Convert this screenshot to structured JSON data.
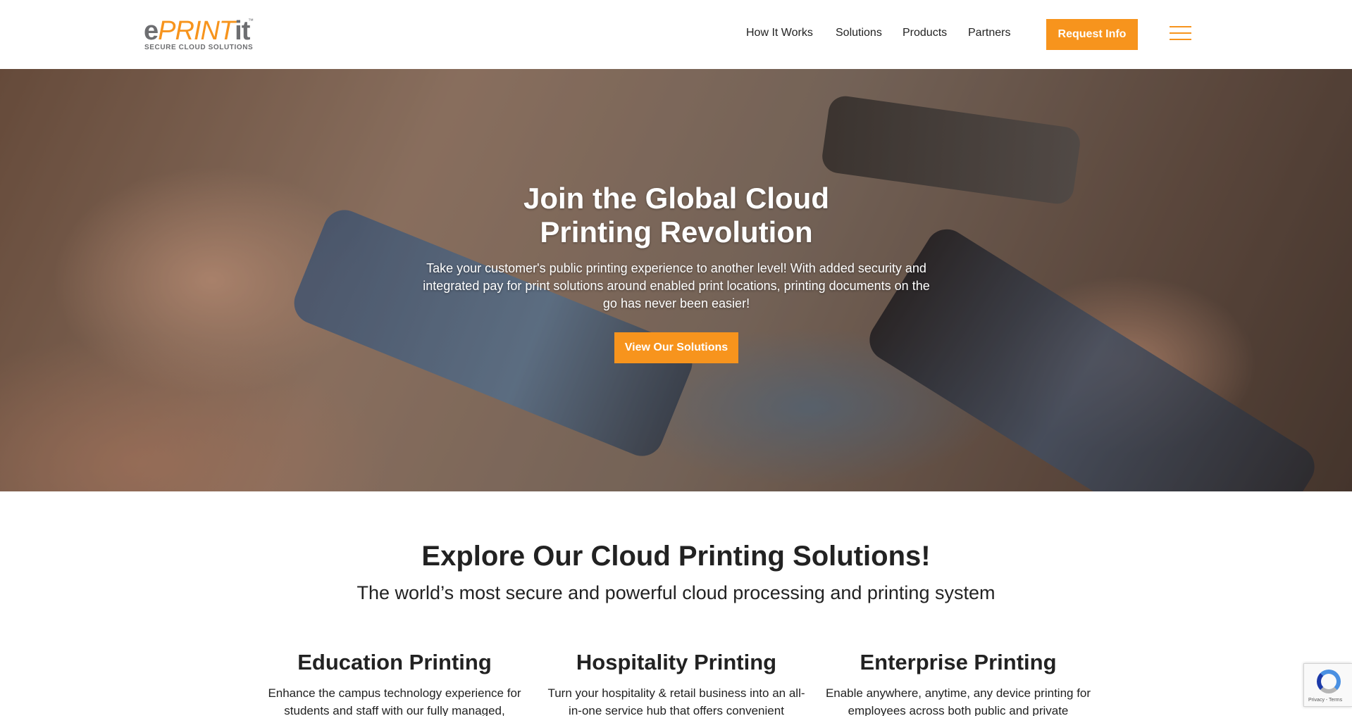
{
  "header": {
    "logo": {
      "e": "e",
      "print": "PRINT",
      "it": "it",
      "tm": "™",
      "tagline": "SECURE CLOUD SOLUTIONS"
    },
    "nav": [
      {
        "label": "How It Works"
      },
      {
        "label": "Solutions"
      },
      {
        "label": "Products"
      },
      {
        "label": "Partners"
      }
    ],
    "cta_label": "Request Info",
    "menu_icon": "hamburger-icon"
  },
  "hero": {
    "title": "Join the Global Cloud Printing Revolution",
    "text": "Take your customer's public printing experience to another level! With added security and integrated pay for print solutions around enabled print locations, printing documents on the go has never been easier!",
    "button_label": "View Our Solutions"
  },
  "explore": {
    "title": "Explore Our Cloud Printing Solutions!",
    "subtitle": "The world’s most secure and powerful cloud processing and printing system"
  },
  "cards": [
    {
      "title": "Education Printing",
      "text": "Enhance the campus technology experience for students and staff with our fully managed,"
    },
    {
      "title": "Hospitality Printing",
      "text": "Turn your hospitality & retail business into an all-in-one service hub that offers convenient"
    },
    {
      "title": "Enterprise Printing",
      "text": "Enable anywhere, anytime, any device printing for employees across both public and private"
    }
  ],
  "recaptcha": {
    "text": "Privacy - Terms"
  },
  "colors": {
    "accent": "#f7941d",
    "logo_gray": "#6d6e71",
    "text": "#222222"
  }
}
